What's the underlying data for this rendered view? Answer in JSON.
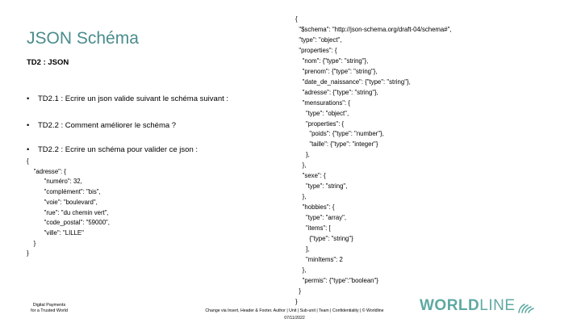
{
  "slide": {
    "title": "JSON Schéma",
    "subtitle": "TD2 : JSON",
    "bullets": [
      "TD2.1 : Ecrire un json valide suivant le schéma suivant :",
      "TD2.2 : Comment améliorer le schéma ?",
      "TD2.2 : Ecrire un schéma pour valider ce json :"
    ],
    "bullet_marker": "•",
    "json_example": "{\n    \"adresse\": {\n          \"numéro\": 32,\n          \"complément\": \"bis\",\n          \"voie\": \"boulevard\",\n          \"rue\": \"du chemin vert\",\n          \"code_postal\": \"59000\",\n          \"ville\": \"LILLE\"\n    }\n}",
    "json_schema": "{\n  \"$schema\": \"http://json-schema.org/draft-04/schema#\",\n  \"type\": \"object\",\n  \"properties\": {\n    \"nom\": {\"type\": \"string\"},\n    \"prenom\": {\"type\": \"string\"},\n    \"date_de_naissance\": {\"type\": \"string\"},\n    \"adresse\": {\"type\": \"string\"},\n    \"mensurations\": {\n      \"type\": \"object\",\n      \"properties\": {\n        \"poids\": {\"type\": \"number\"},\n        \"taille\": {\"type\": \"integer\"}\n      },\n    },\n    \"sexe\": {\n      \"type\": \"string\",\n    },\n    \"hobbies\": {\n      \"type\": \"array\",\n      \"items\": [\n        {\"type\": \"string\"}\n      ],\n      \"minItems\": 2\n    },\n    \"permis\": {\"type\":\"boolean\"}\n  }\n}"
  },
  "footer": {
    "tagline_line1": "Digital Payments",
    "tagline_line2": "for a Trusted World",
    "legal": "Change via Insert, Header & Footer. Author | Unit | Sub-unit | Team | Confidentiality | © Worldline",
    "date": "07/11/2022",
    "logo_bold": "WORLD",
    "logo_light": "LINE"
  },
  "colors": {
    "title": "#4a8c8c",
    "logo": "#5fa9a2"
  }
}
